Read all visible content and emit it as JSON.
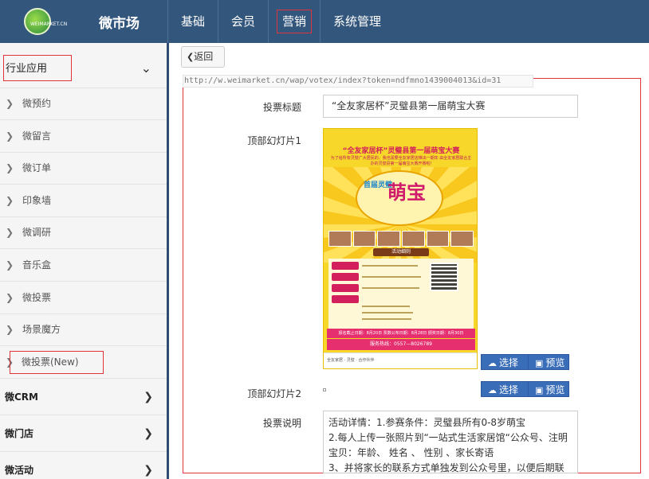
{
  "header": {
    "logo_text": "WEIMARKET.CN",
    "app_title": "微市场",
    "nav": [
      "基础",
      "会员",
      "营销",
      "系统管理"
    ]
  },
  "sidebar": {
    "section_title": "行业应用",
    "items": [
      "微预约",
      "微留言",
      "微订单",
      "印象墙",
      "微调研",
      "音乐盒",
      "微投票",
      "场景魔方",
      "微投票(New)"
    ],
    "groups": [
      "微CRM",
      "微门店",
      "微活动"
    ]
  },
  "main": {
    "back_label": "返回",
    "url": "http://w.weimarket.cn/wap/votex/index?token=ndfmno1439004013&id=31",
    "vote_title_label": "投票标题",
    "vote_title_value": "“全友家居杯”灵璧县第一届萌宝大赛",
    "top_slide1_label": "顶部幻灯片1",
    "top_slide2_label": "顶部幻灯片2",
    "select_label": "选择",
    "preview_label": "预览",
    "description_label": "投票说明",
    "description_lines": [
      "活动详情：1.参赛条件：灵璧县所有0-8岁萌宝",
      "2.每人上传一张照片到“一站式生活家居馆“公众号、注明",
      "宝贝：年龄、 姓名 、 性别 、家长寄语",
      "3、并将家长的联系方式单独发到公众号里，以便后期联"
    ]
  },
  "poster": {
    "headline": "“全友家居杯”灵璧县第一届萌宝大赛",
    "subline": "为了给所有灵璧广大居民的、我也需要全友家居店推出一期年 由全友家居联合主办的灵璧县第一届萌宝大赛开赛啦!",
    "brand_left": "首届灵璧",
    "brand_big": "萌宝",
    "activity": "活动细则",
    "dates": "报名截止日期：8月20日  票数公布日期：8月28日  颁奖日期：8月30日",
    "phone": "服务热线：0557—8026789",
    "footer": "全友家居 · 灵璧 · 合作伙伴"
  }
}
